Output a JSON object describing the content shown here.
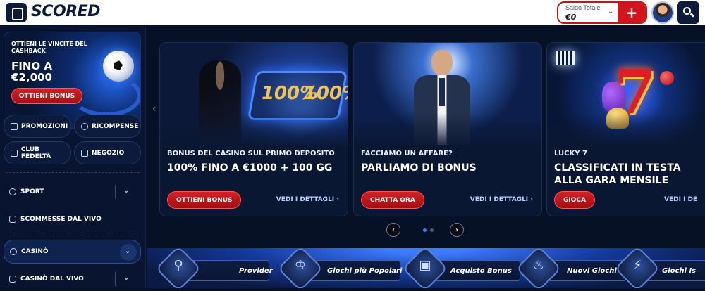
{
  "header": {
    "logo_text": "SCORED",
    "wallet_label": "Saldo Totale",
    "wallet_amount": "€0",
    "add_label": "+"
  },
  "sidebar": {
    "promo": {
      "line1": "OTTIENI LE VINCITE DEL CASHBACK",
      "line2": "FINO A",
      "line3": "€2,000",
      "button": "OTTIENI BONUS"
    },
    "chips": [
      {
        "label": "PROMOZIONI",
        "icon": "gift-icon"
      },
      {
        "label": "RICOMPENSE",
        "icon": "trophy-icon"
      },
      {
        "label": "CLUB FEDELTÀ",
        "icon": "crown-icon"
      },
      {
        "label": "NEGOZIO",
        "icon": "shop-icon"
      }
    ],
    "nav": [
      {
        "label": "SPORT",
        "icon": "soccer-ball-icon"
      },
      {
        "label": "SCOMMESSE DAL VIVO",
        "icon": "live-signal-icon"
      },
      {
        "label": "CASINÒ",
        "icon": "spade-icon"
      },
      {
        "label": "CASINÒ DAL VIVO",
        "icon": "cards-icon"
      }
    ]
  },
  "cards": [
    {
      "subtitle": "BONUS DEL CASINO SUL PRIMO DEPOSITO",
      "title": "100% FINO A €1000 + 100 GG",
      "button": "OTTIENI BONUS",
      "link": "VEDI I DETTAGLI",
      "image_text": "100%"
    },
    {
      "subtitle": "FACCIAMO UN AFFARE?",
      "title": "PARLIAMO DI BONUS",
      "button": "CHATTA ORA",
      "link": "VEDI I DETTAGLI"
    },
    {
      "subtitle": "LUCKY 7",
      "title_line1": "CLASSIFICATI IN TESTA",
      "title_line2": "ALLA GARA MENSILE",
      "button": "GIOCA",
      "link": "VEDI I DE",
      "image_text": "7"
    }
  ],
  "carousel": {
    "pages": 2,
    "active_page": 1
  },
  "categories": [
    {
      "label": "Provider",
      "icon": "magnifier-icon"
    },
    {
      "label": "Giochi più Popolari",
      "icon": "crown-icon"
    },
    {
      "label": "Acquisto Bonus",
      "icon": "gift-box-icon"
    },
    {
      "label": "Nuovi Giochi",
      "icon": "bell-icon"
    },
    {
      "label": "Giochi Is",
      "icon": "lightning-icon"
    }
  ],
  "colors": {
    "accent_red": "#d2151b",
    "navy": "#0d1b3a",
    "link_blue": "#b9d0ff"
  }
}
